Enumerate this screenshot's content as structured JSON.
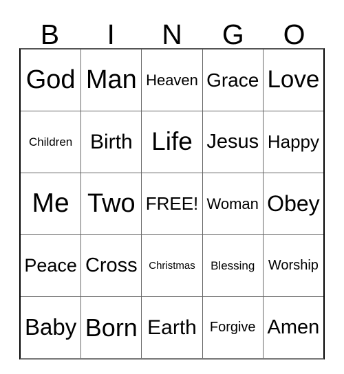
{
  "card": {
    "title": "BINGO",
    "headers": [
      "B",
      "I",
      "N",
      "G",
      "O"
    ],
    "free_space_label": "FREE!",
    "colors": {
      "background": "#ffffff",
      "text": "#000000",
      "grid_line": "#666666",
      "border": "#000000"
    },
    "rows": [
      [
        {
          "label": "God"
        },
        {
          "label": "Man"
        },
        {
          "label": "Heaven"
        },
        {
          "label": "Grace"
        },
        {
          "label": "Love"
        }
      ],
      [
        {
          "label": "Children"
        },
        {
          "label": "Birth"
        },
        {
          "label": "Life"
        },
        {
          "label": "Jesus"
        },
        {
          "label": "Happy"
        }
      ],
      [
        {
          "label": "Me"
        },
        {
          "label": "Two"
        },
        {
          "label": "FREE!"
        },
        {
          "label": "Woman"
        },
        {
          "label": "Obey"
        }
      ],
      [
        {
          "label": "Peace"
        },
        {
          "label": "Cross"
        },
        {
          "label": "Christmas"
        },
        {
          "label": "Blessing"
        },
        {
          "label": "Worship"
        }
      ],
      [
        {
          "label": "Baby"
        },
        {
          "label": "Born"
        },
        {
          "label": "Earth"
        },
        {
          "label": "Forgive"
        },
        {
          "label": "Amen"
        }
      ]
    ]
  }
}
